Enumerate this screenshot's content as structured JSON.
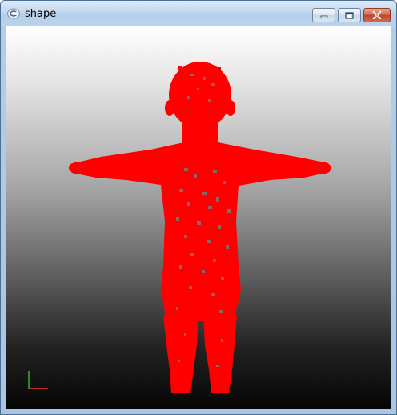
{
  "window": {
    "title": "shape",
    "icon": "app-window-icon"
  },
  "controls": {
    "minimize_icon": "minimize-icon",
    "maximize_icon": "maximize-icon",
    "close_icon": "close-icon"
  },
  "viewport": {
    "background_top": "#ffffff",
    "background_bottom": "#050505",
    "shape_color": "#ff0000",
    "hole_color": "#7a7a7a",
    "axis_x_color": "#ff3030",
    "axis_y_color": "#30c030"
  }
}
